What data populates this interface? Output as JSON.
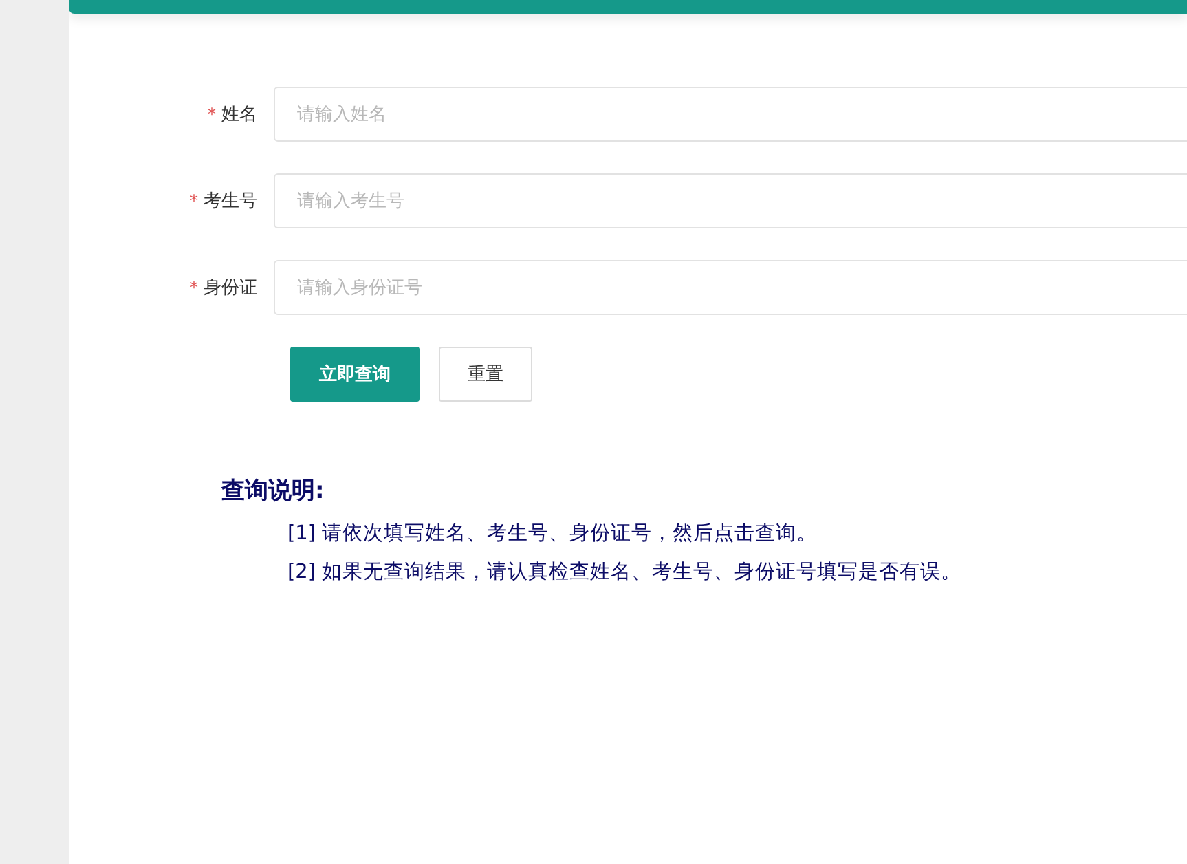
{
  "form": {
    "fields": [
      {
        "mark": "*",
        "label": "姓名",
        "placeholder": "请输入姓名"
      },
      {
        "mark": "*",
        "label": "考生号",
        "placeholder": "请输入考生号"
      },
      {
        "mark": "*",
        "label": "身份证",
        "placeholder": "请输入身份证号"
      }
    ],
    "buttons": [
      {
        "label": "立即查询",
        "kind": "primary"
      },
      {
        "label": "重置",
        "kind": "default"
      }
    ]
  },
  "notes": {
    "title": "查询说明:",
    "items": [
      "[1] 请依次填写姓名、考生号、身份证号，然后点击查询。",
      "[2] 如果无查询结果，请认真检查姓名、考生号、身份证号填写是否有误。"
    ]
  }
}
